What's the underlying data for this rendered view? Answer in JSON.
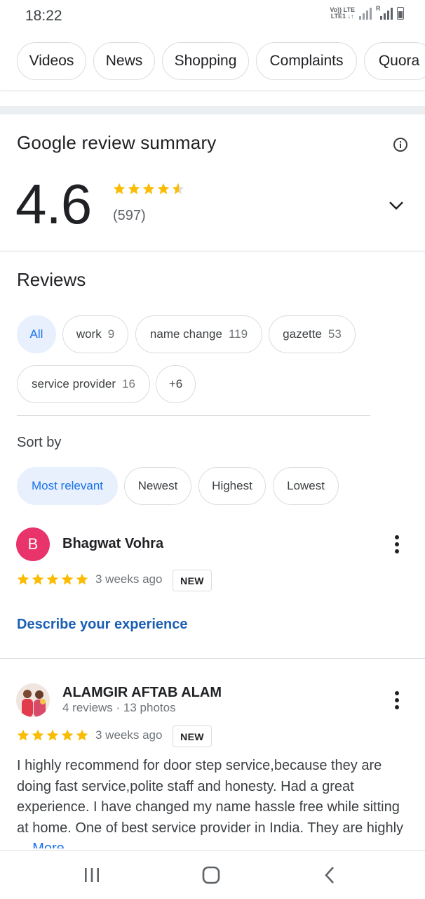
{
  "status_bar": {
    "time": "18:22",
    "network_label_top": "Vo)) LTE",
    "network_label_bottom": "LTE1 ↓↑",
    "roaming": "R"
  },
  "search_tabs": [
    "Videos",
    "News",
    "Shopping",
    "Complaints",
    "Quora"
  ],
  "summary": {
    "title": "Google review summary",
    "rating": "4.6",
    "rating_value": 4.6,
    "review_count": "(597)",
    "info_icon": "info-icon",
    "expand_icon": "chevron-down-icon"
  },
  "reviews": {
    "heading": "Reviews",
    "filters": [
      {
        "label": "All",
        "count": "",
        "selected": true
      },
      {
        "label": "work",
        "count": "9",
        "selected": false
      },
      {
        "label": "name change",
        "count": "119",
        "selected": false
      },
      {
        "label": "gazette",
        "count": "53",
        "selected": false
      },
      {
        "label": "service provider",
        "count": "16",
        "selected": false
      },
      {
        "label": "+6",
        "count": "",
        "selected": false
      }
    ],
    "sort_label": "Sort by",
    "sort_options": [
      {
        "label": "Most relevant",
        "selected": true
      },
      {
        "label": "Newest",
        "selected": false
      },
      {
        "label": "Highest",
        "selected": false
      },
      {
        "label": "Lowest",
        "selected": false
      }
    ],
    "items": [
      {
        "avatar_letter": "B",
        "name": "Bhagwat Vohra",
        "meta": "",
        "stars": 5,
        "time_ago": "3 weeks ago",
        "badge": "NEW",
        "action_link": "Describe your experience"
      },
      {
        "avatar_letter": "",
        "name": "ALAMGIR AFTAB ALAM",
        "meta": "4 reviews · 13 photos",
        "stars": 5,
        "time_ago": "3 weeks ago",
        "badge": "NEW",
        "text": "I highly recommend for door step service,because they are doing fast service,polite staff and honesty. Had a great experience. I have changed my name hassle free while sitting at home. One of best service provider in India. They are highly ...",
        "more_label": "More"
      }
    ]
  },
  "colors": {
    "star": "#fbbc04",
    "accent_blue": "#1a73e8",
    "link_blue": "#1a5fb4",
    "selected_chip_bg": "#e8f0fe",
    "avatar_pink": "#e8336b"
  },
  "nav_bar": {
    "recents_icon": "recents-icon",
    "home_icon": "home-icon",
    "back_icon": "back-icon"
  }
}
